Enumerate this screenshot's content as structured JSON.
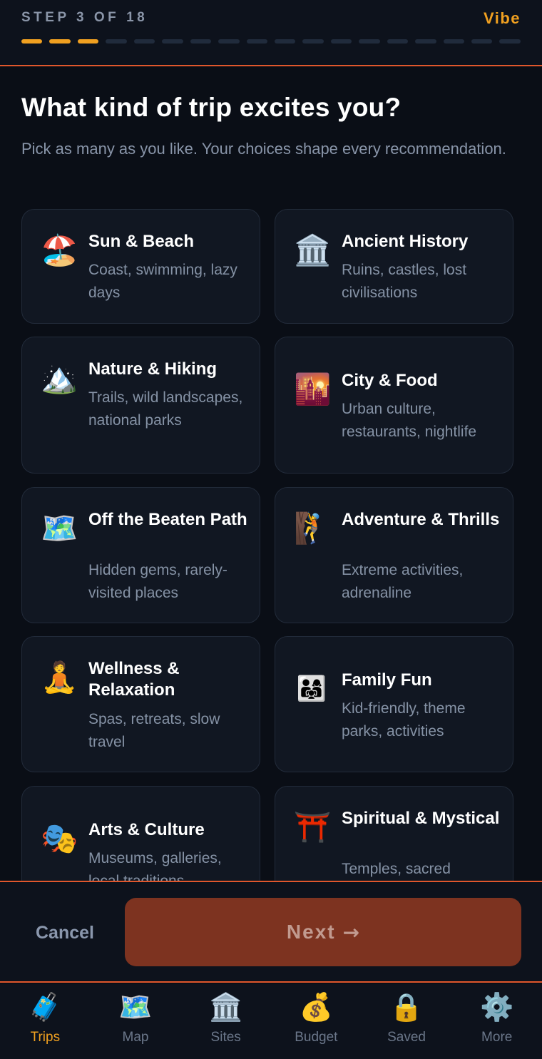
{
  "header": {
    "step_label": "STEP 3 OF 18",
    "phase_label": "Vibe",
    "progress": {
      "current": 3,
      "total": 18
    }
  },
  "question": {
    "title": "What kind of trip excites you?",
    "subtitle": "Pick as many as you like. Your choices shape every recommendation."
  },
  "options": [
    {
      "icon": "beach-umbrella-icon",
      "glyph": "🏖️",
      "title": "Sun & Beach",
      "desc": "Coast, swimming, lazy days"
    },
    {
      "icon": "classical-building-icon",
      "glyph": "🏛️",
      "title": "Ancient History",
      "desc": "Ruins, castles, lost civilisations"
    },
    {
      "icon": "snow-mountain-icon",
      "glyph": "🏔️",
      "title": "Nature & Hiking",
      "desc": "Trails, wild landscapes, national parks"
    },
    {
      "icon": "city-dusk-icon",
      "glyph": "🌇",
      "title": "City & Food",
      "desc": "Urban culture, restaurants, nightlife"
    },
    {
      "icon": "world-map-icon",
      "glyph": "🗺️",
      "title": "Off the Beaten Path",
      "desc": "Hidden gems, rarely-visited places"
    },
    {
      "icon": "climber-icon",
      "glyph": "🧗",
      "title": "Adventure & Thrills",
      "desc": "Extreme activities, adrenaline"
    },
    {
      "icon": "lotus-position-icon",
      "glyph": "🧘",
      "title": "Wellness & Relaxation",
      "desc": "Spas, retreats, slow travel"
    },
    {
      "icon": "family-icon",
      "glyph": "👨‍👩‍👧",
      "title": "Family Fun",
      "desc": "Kid-friendly, theme parks, activities"
    },
    {
      "icon": "theater-masks-icon",
      "glyph": "🎭",
      "title": "Arts & Culture",
      "desc": "Museums, galleries, local traditions"
    },
    {
      "icon": "torii-gate-icon",
      "glyph": "⛩️",
      "title": "Spiritual & Mystical",
      "desc": "Temples, sacred"
    }
  ],
  "actions": {
    "cancel_label": "Cancel",
    "next_label": "Next",
    "next_arrow": "→"
  },
  "nav": [
    {
      "icon": "luggage-icon",
      "glyph": "🧳",
      "label": "Trips",
      "active": true
    },
    {
      "icon": "map-icon",
      "glyph": "🗺️",
      "label": "Map",
      "active": false
    },
    {
      "icon": "landmark-icon",
      "glyph": "🏛️",
      "label": "Sites",
      "active": false
    },
    {
      "icon": "money-bag-icon",
      "glyph": "💰",
      "label": "Budget",
      "active": false
    },
    {
      "icon": "padlock-icon",
      "glyph": "🔒",
      "label": "Saved",
      "active": false
    },
    {
      "icon": "gear-icon",
      "glyph": "⚙️",
      "label": "More",
      "active": false
    }
  ],
  "colors": {
    "accent": "#f0a020",
    "divider": "#e0572c",
    "next_button": "#7d3320",
    "background": "#0a0e16",
    "card": "#111722"
  }
}
